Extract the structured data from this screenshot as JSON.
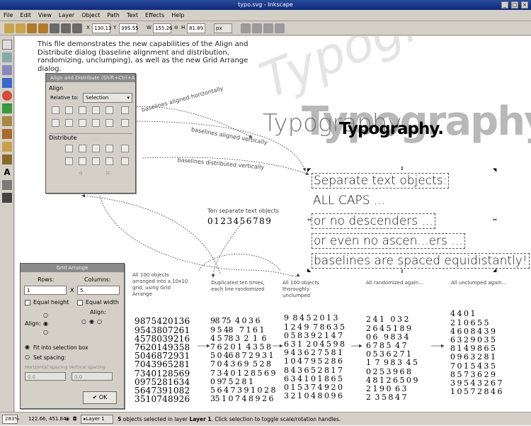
{
  "window": {
    "title": "typo.svg - Inkscape"
  },
  "menu": [
    "File",
    "Edit",
    "View",
    "Layer",
    "Object",
    "Path",
    "Text",
    "Effects",
    "Help"
  ],
  "toolbar": {
    "x_label": "X",
    "x_value": "130.13",
    "y_label": "Y",
    "y_value": "395.55",
    "w_label": "W",
    "w_value": "155.26",
    "h_label": "H",
    "h_value": "81.89",
    "unit": "px"
  },
  "intro_text": "This file demonstrates the new capabilities of the Align and Distribute dialog (baseline alignment and distribution, randomizing, unclumping), as well as the new Grid Arrange dialog.",
  "align_dialog": {
    "title": "Align and Distribute (Shift+Ctrl+A)",
    "align_header": "Align",
    "relative_label": "Relative to:",
    "relative_value": "Selection",
    "distribute_header": "Distribute"
  },
  "annotations": {
    "horiz": "baselines aligned horizontally",
    "vert": "baselines aligned vertically",
    "dist": "baselines distributed vertically",
    "ten": "Ten separate text objects"
  },
  "typography": {
    "word": "Typography",
    "word_dot": "Typography."
  },
  "text_objects": [
    "Separate text objects:",
    "ALL CAPS ...",
    "or no descenders ...",
    "or even no ascen...ers ...",
    "baselines are spaced equidistantly!"
  ],
  "digits_row": "0123456789",
  "grid_dialog": {
    "title": "Grid Arrange",
    "rows_label": "Rows:",
    "rows_value": "1",
    "columns_label": "Columns:",
    "columns_value": "5",
    "times": "X",
    "equal_height": "Equal height",
    "equal_width": "Equal width",
    "align_left": "Align:",
    "align_right": "Align:",
    "fit": "Fit into selection box",
    "set_spacing": "Set spacing:",
    "spacing_labels": "Horizontal spacing  Vertical spacing",
    "spacing_h": "0.0",
    "spacing_v": "0.0",
    "ok": "OK"
  },
  "grid_headings": [
    "All 100 objects arranged into a 10x10 grid, using Grid Arrange",
    "Duplicated ten times, each line randomized",
    "All 100 objects thoroughly unclumped",
    "All randomized again...",
    "All unclumped again..."
  ],
  "grid_rows": [
    "9875420136",
    "9543807261",
    "4578039216",
    "7620149358",
    "5046872931",
    "7043965281",
    "7340128569",
    "0975281634",
    "5647391082",
    "3510748926"
  ],
  "random_rows": [
    "98 75  4 0 3 6",
    "9 5 48   7 1 6 1",
    "4 5 78 3  2  1  6",
    "7 6 2 0 1  4 3 5 8",
    "5 0 46 8 7 2 9 3 1",
    "7 0 4 3 6 9  5 2 8",
    "7 3 4 0 1 2 8 5 6 9",
    "0 97 5 2 8 1",
    "5 6 4 7 3 9 1 0 2 8",
    "35 1 0 7 4 8 9 2 6"
  ],
  "unclumped_rows": [
    "9  8 4 5 2 0 1 3",
    "1 2 4 9  7 8 6 3 5",
    "0 5 8 3 9 2 1 4 7",
    "6 3 1  2 0 4 5 9 8",
    "9 4 3 6 2 7 5 8 1",
    "1 0 4 7 9 5 2 8 6",
    "8 4 3 6 5 2 8 1 7",
    "6 3 4 1 0 1 8 6 5",
    "0 1 5 3 7 4 9 2 0",
    "3 2 1 0 4 8 0 9 6"
  ],
  "random2_rows": [
    "2 4 1   0 3 2",
    "2 6 4 5 1 8 9",
    "0 6   9 8 3 4",
    "6 7 8 5  4 7",
    "0 5 3 6 2 7 1",
    "1  7  9 8 3  4 5",
    "0 2 5 3 9 6 8",
    "4 8 1 2 6 5 0 9",
    "2 1 9 0  6 3",
    "2  3 5 8 4 7"
  ],
  "unclumped2_rows": [
    "4 4 0 1",
    "2 1 0 6 5 5",
    "4 6 0 8 4 3 9",
    "6 3 2 9 0 3 5",
    "8 1 4 9 8 6 5",
    "0 9 6 3 2 8 1",
    "7 0 1 5 4 3 5",
    "8 5 7 3 6 2 9",
    "3 9 5 4 3 2 6 7",
    "1 0 5 7 2 8 4 6"
  ],
  "status": {
    "zoom": "283%",
    "coords": "122.66, 451.84",
    "layer": "Layer 1",
    "message_prefix": "5",
    "message_mid": " objects selected in layer ",
    "message_layer": "Layer 1",
    "message_suffix": ". Click selection to toggle scale/rotation handles."
  }
}
